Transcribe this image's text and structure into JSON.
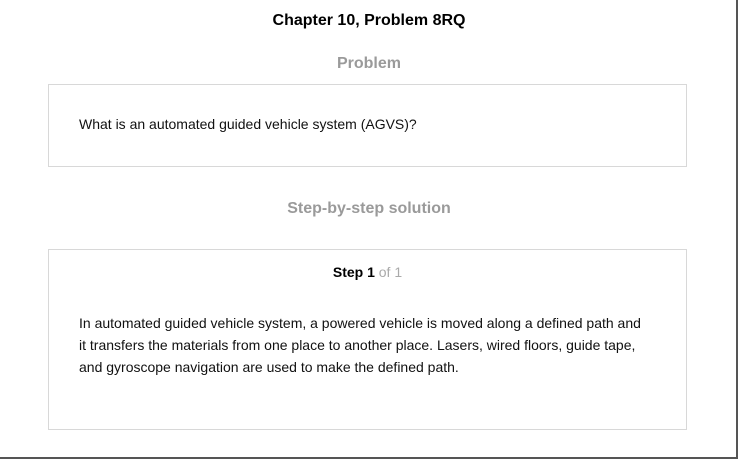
{
  "page": {
    "title": "Chapter 10, Problem 8RQ"
  },
  "problem": {
    "heading": "Problem",
    "question": "What is an automated guided vehicle system (AGVS)?"
  },
  "solution": {
    "heading": "Step-by-step solution",
    "step": {
      "label": "Step 1",
      "of_text": "of 1",
      "lines": [
        "In automated guided vehicle system, a powered vehicle is moved along a defined path and",
        "it transfers the materials from one place to another place. Lasers, wired floors, guide tape,",
        "and gyroscope navigation are used to make the defined path."
      ]
    }
  }
}
